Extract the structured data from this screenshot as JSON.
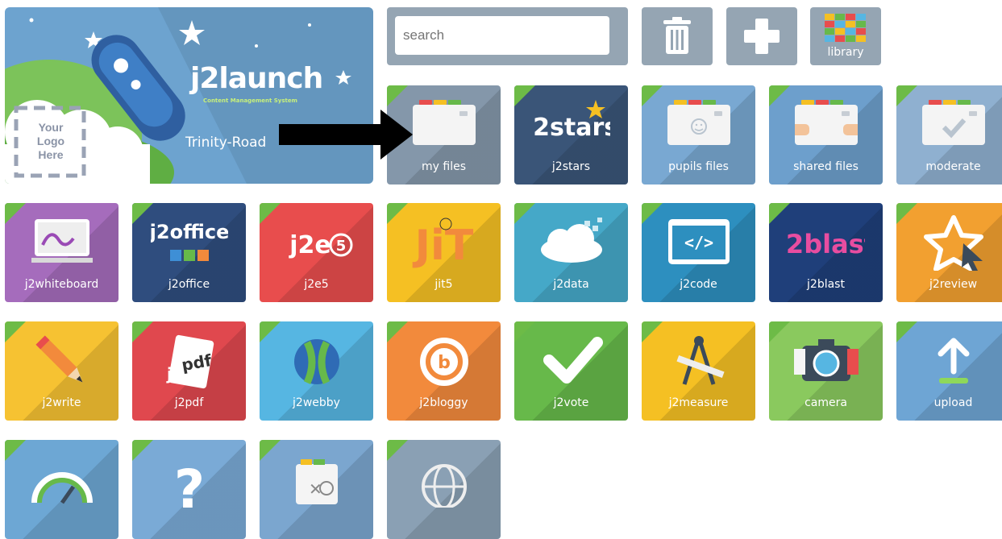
{
  "hero": {
    "brand": "j2launch",
    "tagline": "Content Management System",
    "logo_placeholder": [
      "Your",
      "Logo",
      "Here"
    ],
    "school": "Trinity-Road",
    "bg_color": "#6da3cf"
  },
  "search": {
    "placeholder": "search"
  },
  "toolbar": {
    "delete_icon": "trash-icon",
    "add_icon": "plus-icon",
    "library_label": "library"
  },
  "tiles": [
    {
      "label": "my files",
      "color": "#8497aa",
      "icon": "folder-icon"
    },
    {
      "label": "j2stars",
      "color": "#3a5578",
      "icon": "j2stars-logo"
    },
    {
      "label": "pupils files",
      "color": "#79a8d2",
      "icon": "folder-smiley-icon"
    },
    {
      "label": "shared files",
      "color": "#6d9fcc",
      "icon": "shared-folder-icon"
    },
    {
      "label": "moderate",
      "color": "#8fb0d0",
      "icon": "moderate-folder-icon"
    },
    {
      "label": "j2whiteboard",
      "color": "#a56cbc",
      "icon": "whiteboard-icon"
    },
    {
      "label": "j2office",
      "color": "#2f4d7e",
      "icon": "j2office-logo"
    },
    {
      "label": "j2e5",
      "color": "#e84d4d",
      "icon": "j2e5-logo"
    },
    {
      "label": "jit5",
      "color": "#f5c023",
      "icon": "jit-logo"
    },
    {
      "label": "j2data",
      "color": "#45a8c8",
      "icon": "cloud-data-icon"
    },
    {
      "label": "j2code",
      "color": "#2d8fbf",
      "icon": "code-icon"
    },
    {
      "label": "j2blast",
      "color": "#1f3f7a",
      "icon": "j2blast-logo"
    },
    {
      "label": "j2review",
      "color": "#f2a030",
      "icon": "star-cursor-icon"
    },
    {
      "label": "j2write",
      "color": "#f6c232",
      "icon": "pencil-icon"
    },
    {
      "label": "j2pdf",
      "color": "#e0484e",
      "icon": "pdf-icon"
    },
    {
      "label": "j2webby",
      "color": "#56b6e2",
      "icon": "webby-icon"
    },
    {
      "label": "j2bloggy",
      "color": "#f28a3c",
      "icon": "bloggy-icon"
    },
    {
      "label": "j2vote",
      "color": "#67b94a",
      "icon": "checkmark-icon"
    },
    {
      "label": "j2measure",
      "color": "#f5c023",
      "icon": "compass-icon"
    },
    {
      "label": "camera",
      "color": "#8ac95e",
      "icon": "camera-icon"
    },
    {
      "label": "upload",
      "color": "#6ea5d4",
      "icon": "upload-icon"
    },
    {
      "label": "",
      "color": "#6da7d4",
      "icon": "gauge-icon"
    },
    {
      "label": "",
      "color": "#7aaad6",
      "icon": "help-icon"
    },
    {
      "label": "",
      "color": "#7ba6cf",
      "icon": "tools-folder-icon"
    },
    {
      "label": "",
      "color": "#8aa0b4",
      "icon": "globe-icon"
    }
  ],
  "annotation": {
    "arrow": "arrow-right-icon"
  }
}
